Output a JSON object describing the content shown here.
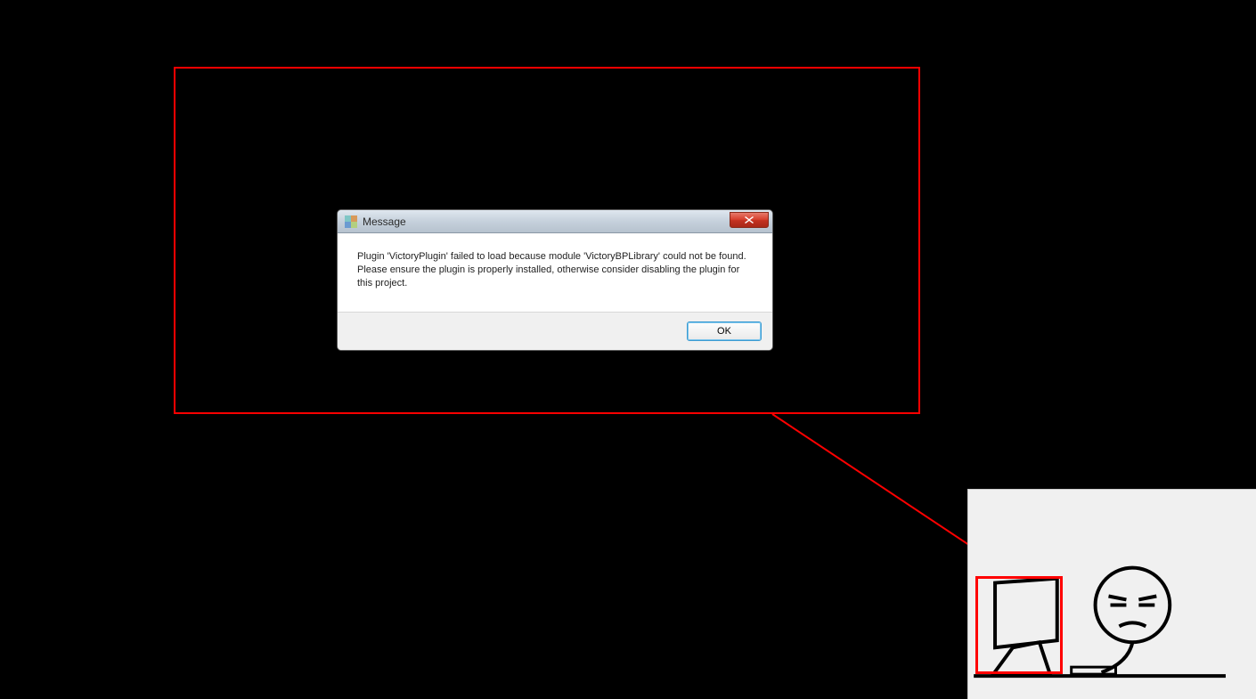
{
  "dialog": {
    "title": "Message",
    "body": "Plugin 'VictoryPlugin' failed to load because module 'VictoryBPLibrary' could not be found.  Please ensure the plugin is properly installed, otherwise consider disabling the plugin for this project.",
    "ok_label": "OK"
  },
  "annotation": {
    "highlight_color": "#ff0000"
  }
}
